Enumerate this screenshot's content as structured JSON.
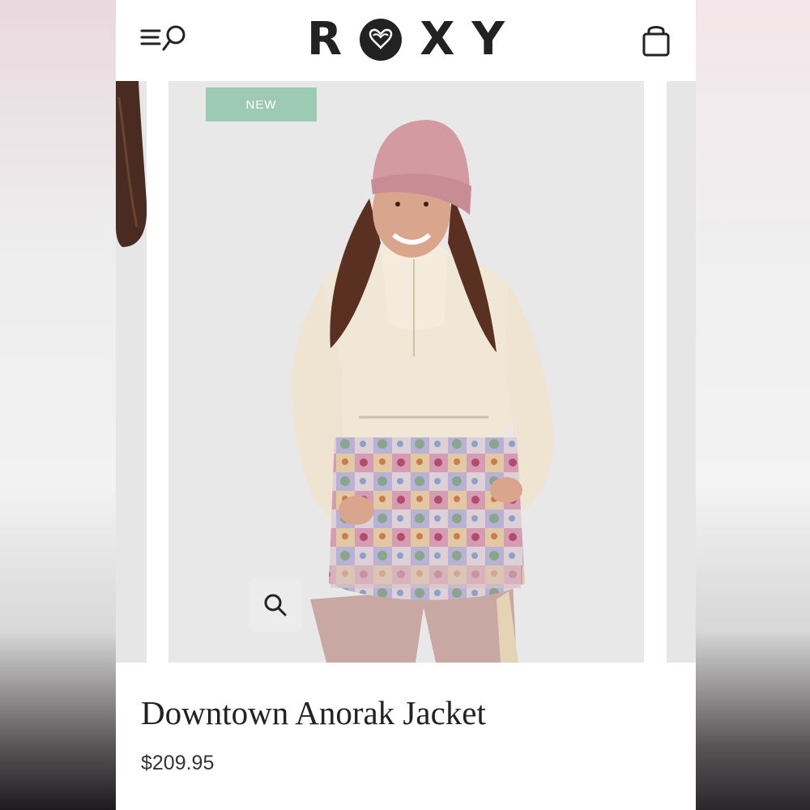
{
  "header": {
    "logo_text": [
      "R",
      "X",
      "Y"
    ],
    "logo_text_before_mark": "R",
    "logo_text_after_mark": [
      "X",
      "Y"
    ],
    "menu_icon": "menu-search-icon",
    "cart_icon": "shopping-bag-icon"
  },
  "product": {
    "badge": "NEW",
    "name": "Downtown Anorak Jacket",
    "price": "$209.95",
    "zoom_icon": "magnifier-icon"
  },
  "colors": {
    "badge_bg": "#9ccab4",
    "text": "#222222",
    "photo_bg": "#e8e8e8"
  }
}
